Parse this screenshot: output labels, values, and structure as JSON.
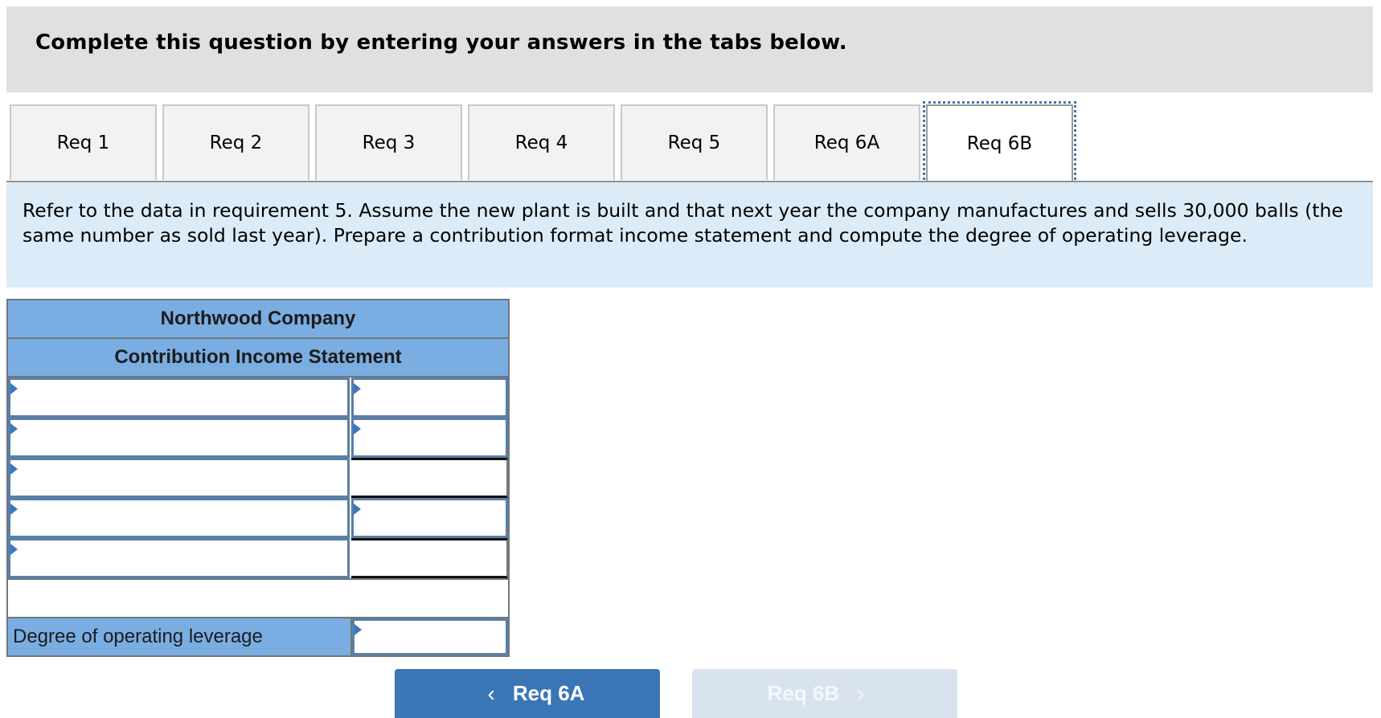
{
  "header": {
    "title": "Complete this question by entering your answers in the tabs below."
  },
  "tabs": [
    {
      "label": "Req 1",
      "active": false
    },
    {
      "label": "Req 2",
      "active": false
    },
    {
      "label": "Req 3",
      "active": false
    },
    {
      "label": "Req 4",
      "active": false
    },
    {
      "label": "Req 5",
      "active": false
    },
    {
      "label": "Req 6A",
      "active": false
    },
    {
      "label": "Req 6B",
      "active": true
    }
  ],
  "instructions": "Refer to the data in requirement 5. Assume the new plant is built and that next year the company manufactures and sells 30,000 balls (the same number as sold last year). Prepare a contribution format income statement and compute the degree of operating leverage.",
  "statement": {
    "company": "Northwood Company",
    "title": "Contribution Income Statement",
    "rows": [
      {
        "label_value": "",
        "amount_value": "",
        "amount_editable": true
      },
      {
        "label_value": "",
        "amount_value": "",
        "amount_editable": true
      },
      {
        "label_value": "",
        "amount_value": "",
        "amount_editable": false
      },
      {
        "label_value": "",
        "amount_value": "",
        "amount_editable": true
      },
      {
        "label_value": "",
        "amount_value": "",
        "amount_editable": false
      }
    ],
    "dol_label": "Degree of operating leverage",
    "dol_value": ""
  },
  "nav": {
    "prev_label": "Req 6A",
    "next_label": "Req 6B",
    "prev_icon": "chevron-left-icon",
    "next_icon": "chevron-right-icon",
    "next_disabled": true
  },
  "colors": {
    "header_bg": "#e0e0e0",
    "instructions_bg": "#dbebf7",
    "table_header_bg": "#7aade1",
    "primary_button": "#3a76b6",
    "disabled_button": "#d8e3ef",
    "active_tab_outline": "#3f74b3"
  }
}
